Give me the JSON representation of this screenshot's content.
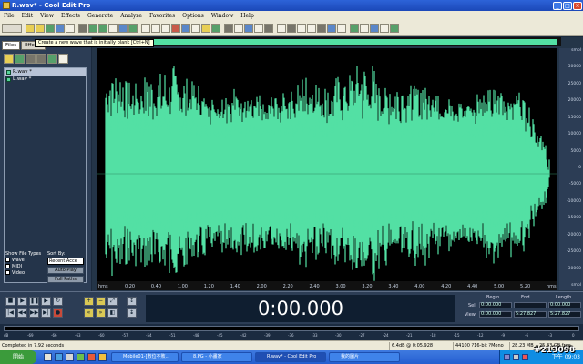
{
  "window": {
    "title": "R.wav* - Cool Edit Pro"
  },
  "menu": [
    "File",
    "Edit",
    "View",
    "Effects",
    "Generate",
    "Analyze",
    "Favorites",
    "Options",
    "Window",
    "Help"
  ],
  "tooltip": "Create a new wave that is initially blank   [Ctrl+N]",
  "panel": {
    "tabs": [
      "Files",
      "Effects"
    ],
    "files": [
      "R.wav *",
      "L.wav *"
    ],
    "show_types_label": "Show File Types",
    "types": [
      "Wave",
      "MIDI",
      "Video"
    ],
    "sort_label": "Sort By:",
    "sort_value": "Recent Acce",
    "autoplay": "Auto Play",
    "fullpaths": "Full Paths"
  },
  "waveform": {
    "color": "#53e0a4",
    "y_ticks": [
      "smpl",
      "30000",
      "25000",
      "20000",
      "15000",
      "10000",
      "5000",
      "0",
      "-5000",
      "-10000",
      "-15000",
      "-20000",
      "-25000",
      "-30000",
      "smpl"
    ],
    "x_ticks": [
      "hms",
      "0.20",
      "0.40",
      "1.00",
      "1.20",
      "1.40",
      "2.00",
      "2.20",
      "2.40",
      "3.00",
      "3.20",
      "3.40",
      "4.00",
      "4.20",
      "4.40",
      "5.00",
      "5.20",
      "hms"
    ]
  },
  "transport": {
    "time": "0:00.000",
    "headers": [
      "Begin",
      "End",
      "Length"
    ],
    "sel_label": "Sel",
    "view_label": "View",
    "sel": [
      "0:00.000",
      "",
      "0:00.000"
    ],
    "view": [
      "0:00.000",
      "5:27.827",
      "5:27.827"
    ]
  },
  "meter_ticks": [
    "dB",
    "-69",
    "-66",
    "-63",
    "-60",
    "-57",
    "-54",
    "-51",
    "-48",
    "-45",
    "-42",
    "-39",
    "-36",
    "-33",
    "-30",
    "-27",
    "-24",
    "-21",
    "-18",
    "-15",
    "-12",
    "-9",
    "-6",
    "-3",
    "0"
  ],
  "status": {
    "message": "Completed in 7.92 seconds",
    "level": "6.4dB @ 0:05.928",
    "format": "44100 ?16-bit ?Mono",
    "size": "28.23 MB",
    "free": "25.33 GB free"
  },
  "taskbar": {
    "start": "開始",
    "tasks": [
      "Mobile01-[數位不敗...",
      "8.PG - 小畫家",
      "R.wav* - Cool Edit Pro",
      "我的圖片"
    ],
    "clock": "下午 09:03"
  },
  "watermark": "#213098"
}
